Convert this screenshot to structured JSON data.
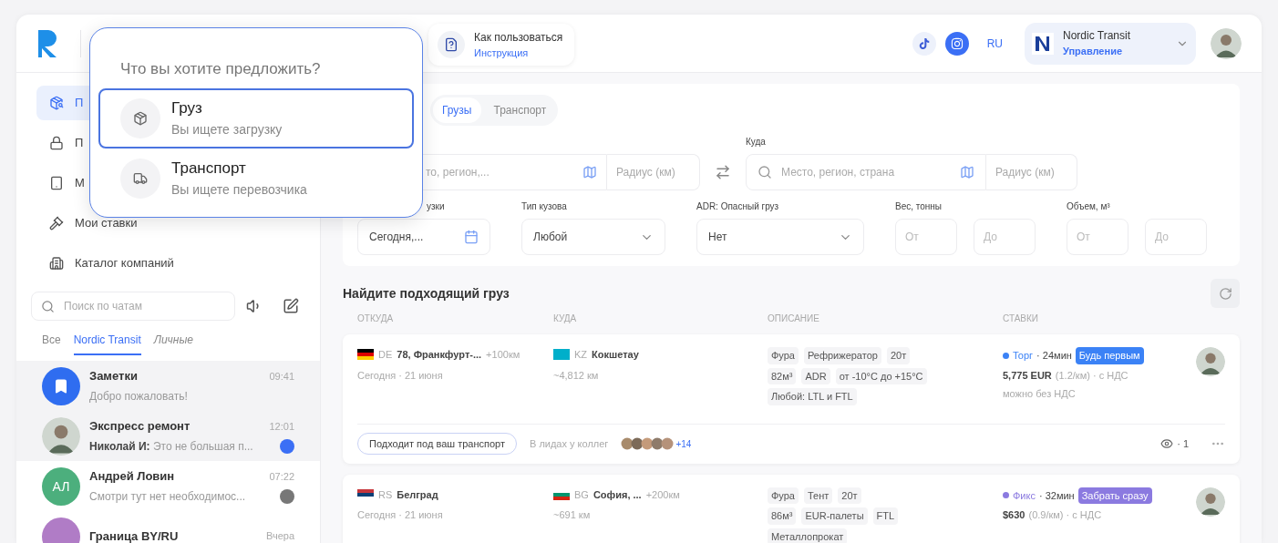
{
  "header": {
    "how_to": {
      "title": "Как пользоваться",
      "link": "Инструкция"
    },
    "lang": "RU",
    "company": {
      "name": "Nordic Transit",
      "role": "Управление"
    }
  },
  "sidebar": {
    "nav": [
      {
        "label": "П",
        "selected": true
      },
      {
        "label": "П",
        "selected": false
      },
      {
        "label": "М",
        "selected": false
      },
      {
        "label": "Мои ставки",
        "selected": false
      },
      {
        "label": "Каталог компаний",
        "selected": false
      }
    ],
    "chat_search": {
      "placeholder": "Поиск по чатам"
    },
    "chat_tabs": [
      {
        "label": "Все",
        "selected": false
      },
      {
        "label": "Nordic Transit",
        "selected": true
      },
      {
        "label": "Личные",
        "selected": false
      }
    ],
    "chats": [
      {
        "kind": "notes",
        "name": "Заметки",
        "preview": "Добро пожаловать!",
        "time": "09:41",
        "selected": true
      },
      {
        "kind": "photo",
        "name": "Экспресс ремонт",
        "author": "Николай И:",
        "preview": "Это не большая п...",
        "time": "12:01",
        "selected": true,
        "unread": true,
        "muted": false
      },
      {
        "kind": "initials",
        "initials": "АЛ",
        "color": "#4caf7d",
        "name": "Андрей Ловин",
        "preview": "Смотри тут нет необходимос...",
        "time": "07:22",
        "selected": false,
        "unread": true,
        "muted": true
      },
      {
        "kind": "initials",
        "color": "#b07cc6",
        "name": "Граница BY/RU",
        "time": "Вчера",
        "selected": false
      }
    ]
  },
  "search": {
    "tabs": [
      {
        "label": "Грузы",
        "selected": true
      },
      {
        "label": "Транспорт",
        "selected": false
      }
    ],
    "from": {
      "placeholder": "то, регион,...",
      "radius": {
        "placeholder": "Радиус (км)"
      }
    },
    "to": {
      "label": "Куда",
      "placeholder": "Место, регион, страна",
      "radius": {
        "placeholder": "Радиус (км)"
      }
    },
    "date": {
      "label": "узки",
      "value": "Сегодня,..."
    },
    "body": {
      "label": "Тип кузова",
      "value": "Любой"
    },
    "adr": {
      "label": "ADR: Опасный груз",
      "value": "Нет"
    },
    "weight": {
      "label": "Вес, тонны",
      "from": {
        "placeholder": "От"
      },
      "to": {
        "placeholder": "До"
      }
    },
    "volume": {
      "label": "Объем, м³",
      "from": {
        "placeholder": "От"
      },
      "to": {
        "placeholder": "До"
      }
    }
  },
  "results": {
    "title": "Найдите подходящий груз",
    "columns": [
      "ОТКУДА",
      "КУДА",
      "ОПИСАНИЕ",
      "СТАВКИ"
    ],
    "rows": [
      {
        "from": {
          "flag": [
            {
              "color": "#000000"
            },
            {
              "color": "#dd0000"
            },
            {
              "color": "#ffce00"
            }
          ],
          "code": "DE",
          "city": "78, Франкфурт-...",
          "radius": "+100км",
          "date": "Сегодня · 21 июня"
        },
        "to": {
          "flag": [
            {
              "color": "#00afca"
            }
          ],
          "code": "KZ",
          "city": "Кокшетау",
          "distance": "~4,812 км"
        },
        "tags": [
          [
            "Фура",
            "Рефрижератор",
            "20т"
          ],
          [
            "82м³",
            "ADR",
            "от -10°C до +15°C"
          ],
          [
            "Любой: LTL и FTL"
          ]
        ],
        "rate": {
          "color": "#3b82f6",
          "type": "Торг",
          "time": "· 24мин",
          "badge": "Будь первым",
          "price": "5,775 EUR",
          "note": "(1.2/км) · с НДС",
          "extra": "можно без НДС"
        },
        "footer": {
          "match": "Подходит под ваш транспорт",
          "leads": "В лидах у коллег",
          "more": "+14",
          "views": "· 1"
        }
      },
      {
        "from": {
          "flag": [
            {
              "color": "#c6363c"
            },
            {
              "color": "#0c4076"
            },
            {
              "color": "#ffffff"
            }
          ],
          "code": "RS",
          "city": "Белград",
          "date": "Сегодня · 21 июня"
        },
        "to": {
          "flag": [
            {
              "color": "#ffffff"
            },
            {
              "color": "#00966e"
            },
            {
              "color": "#d62612"
            }
          ],
          "code": "BG",
          "city": "София, ...",
          "radius": "+200км",
          "distance": "~691 км"
        },
        "tags": [
          [
            "Фура",
            "Тент",
            "20т"
          ],
          [
            "86м³",
            "EUR-палеты",
            "FTL"
          ],
          [
            "Металлопрокат"
          ]
        ],
        "rate": {
          "color": "#8b7ae0",
          "type": "Фикс",
          "time": "· 32мин",
          "badge": "Забрать сразу",
          "price": "$630",
          "note": "(0.9/км) · с НДС"
        }
      }
    ]
  },
  "popup": {
    "title": "Что вы хотите предложить?",
    "options": [
      {
        "kind": "cargo",
        "title": "Груз",
        "subtitle": "Вы ищете загрузку",
        "selected": true
      },
      {
        "kind": "transport",
        "title": "Транспорт",
        "subtitle": "Вы ищете перевозчика",
        "selected": false
      }
    ]
  }
}
